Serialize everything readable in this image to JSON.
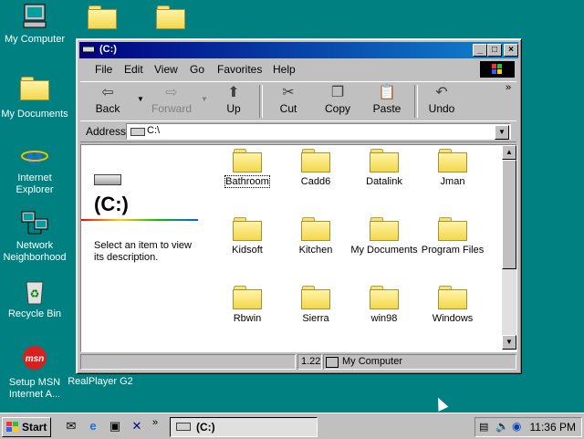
{
  "desktop": {
    "icons": [
      {
        "label": "My Computer",
        "icon": "computer-icon"
      },
      {
        "label": "My Documents",
        "icon": "documents-folder-icon"
      },
      {
        "label": "Internet Explorer",
        "icon": "internet-explorer-icon"
      },
      {
        "label": "Network Neighborhood",
        "icon": "network-icon"
      },
      {
        "label": "Recycle Bin",
        "icon": "recycle-bin-icon"
      },
      {
        "label": "Setup MSN Internet A...",
        "icon": "msn-icon"
      },
      {
        "label": "RealPlayer G2",
        "icon": "realplayer-icon"
      }
    ]
  },
  "window": {
    "title": "(C:)",
    "menu": [
      "File",
      "Edit",
      "View",
      "Go",
      "Favorites",
      "Help"
    ],
    "toolbar": {
      "back": "Back",
      "forward": "Forward",
      "up": "Up",
      "cut": "Cut",
      "copy": "Copy",
      "paste": "Paste",
      "undo": "Undo",
      "more": "»"
    },
    "address": {
      "label": "Address",
      "value": "C:\\"
    },
    "left_pane": {
      "title": "(C:)",
      "description": "Select an item to view its description."
    },
    "folders": [
      "Bathroom",
      "Cadd6",
      "Datalink",
      "Jman",
      "Kidsoft",
      "Kitchen",
      "My Documents",
      "Program Files",
      "Rbwin",
      "Sierra",
      "win98",
      "Windows"
    ],
    "status": {
      "size": "1.22",
      "location": "My Computer"
    }
  },
  "taskbar": {
    "start": "Start",
    "quicklaunch_more": "»",
    "task": "(C:)",
    "time": "11:36 PM"
  },
  "colors": {
    "desktop": "#008080",
    "title_active": "#000080",
    "folder": "#f2d84c"
  }
}
